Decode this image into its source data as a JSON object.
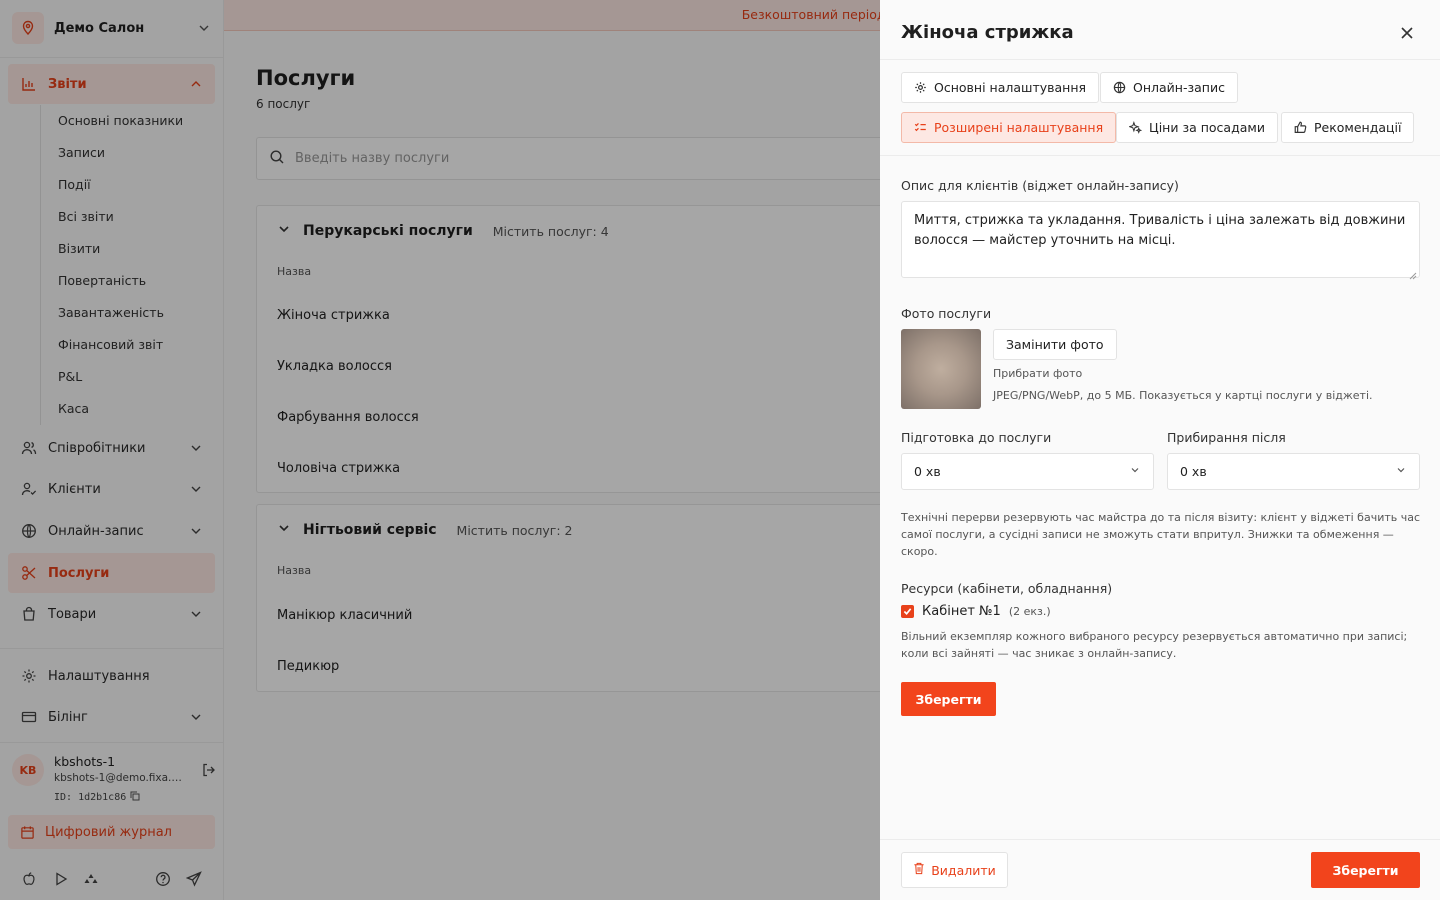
{
  "sidebar": {
    "salon_name": "Демо Салон",
    "nav": {
      "reports": "Звіти",
      "staff": "Співробітники",
      "clients": "Клієнти",
      "online_booking": "Онлайн-запис",
      "services": "Послуги",
      "goods": "Товари",
      "settings": "Налаштування",
      "billing": "Білінг"
    },
    "report_items": [
      "Основні показники",
      "Записи",
      "Події",
      "Всі звіти",
      "Візити",
      "Повертаність",
      "Завантаженість",
      "Фінансовий звіт",
      "P&L",
      "Каса"
    ],
    "user": {
      "initials": "KB",
      "name": "kbshots-1",
      "email": "kbshots-1@demo.fixa.b...",
      "id": "ID: 1d2b1c86"
    },
    "journal": "Цифровий журнал"
  },
  "main": {
    "trial_banner": "Безкоштовний період — до",
    "title": "Послуги",
    "subtitle": "6 послуг",
    "search_placeholder": "Введіть назву послуги",
    "groups": [
      {
        "title": "Перукарські послуги",
        "count": "Містить послуг: 4",
        "col_name": "Назва",
        "services": [
          "Жіноча стрижка",
          "Укладка волосся",
          "Фарбування волосся",
          "Чоловіча стрижка"
        ]
      },
      {
        "title": "Нігтьовий сервіс",
        "count": "Містить послуг: 2",
        "col_name": "Назва",
        "services": [
          "Манікюр класичний",
          "Педикюр"
        ]
      }
    ]
  },
  "drawer": {
    "title": "Жіноча стрижка",
    "tabs": {
      "basic": "Основні налаштування",
      "online": "Онлайн-запис",
      "advanced": "Розширені налаштування",
      "prices": "Ціни за посадами",
      "recommendations": "Рекомендації"
    },
    "desc_label": "Опис для клієнтів (віджет онлайн-запису)",
    "desc_value": "Миття, стрижка та укладання. Тривалість і ціна залежать від довжини волосся — майстер уточнить на місці.",
    "photo_label": "Фото послуги",
    "replace_photo": "Замінити фото",
    "remove_photo": "Прибрати фото",
    "photo_hint": "JPEG/PNG/WebP, до 5 МБ. Показується у картці послуги у віджеті.",
    "prep_label": "Підготовка до послуги",
    "prep_value": "0 хв",
    "cleanup_label": "Прибирання після",
    "cleanup_value": "0 хв",
    "breaks_info": "Технічні перерви резервують час майстра до та після візиту: клієнт у віджеті бачить час самої послуги, а сусідні записи не зможуть стати впритул. Знижки та обмеження — скоро.",
    "resources_label": "Ресурси (кабінети, обладнання)",
    "resource_name": "Кабінет №1",
    "resource_qty": "(2 екз.)",
    "resources_info": "Вільний екземпляр кожного вибраного ресурсу резервується автоматично при записі; коли всі зайняті — час зникає з онлайн-запису.",
    "save_inline": "Зберегти",
    "delete": "Видалити",
    "save": "Зберегти"
  },
  "colors": {
    "accent": "#f2441c",
    "accent_soft": "#fde8e3"
  }
}
